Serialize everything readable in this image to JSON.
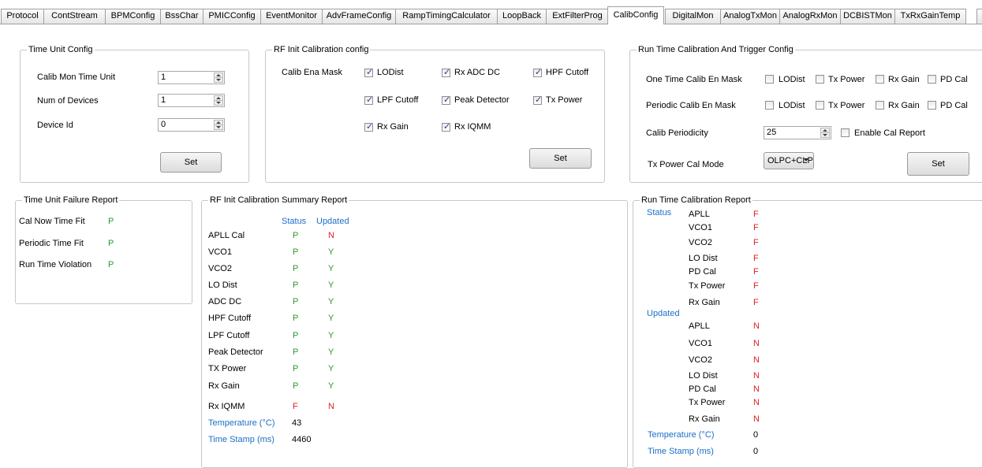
{
  "tabs": [
    "Protocol",
    "ContStream",
    "BPMConfig",
    "BssChar",
    "PMICConfig",
    "EventMonitor",
    "AdvFrameConfig",
    "RampTimingCalculator",
    "LoopBack",
    "ExtFilterProg",
    "CalibConfig",
    "DigitalMon",
    "AnalogTxMon",
    "AnalogRxMon",
    "DCBISTMon",
    "TxRxGainTemp"
  ],
  "active_tab": "CalibConfig",
  "time_unit_config": {
    "title": "Time Unit Config",
    "calib_mon_label": "Calib Mon Time Unit",
    "calib_mon_value": "1",
    "num_devices_label": "Num of  Devices",
    "num_devices_value": "1",
    "device_id_label": "Device Id",
    "device_id_value": "0",
    "set_label": "Set"
  },
  "rf_init_config": {
    "title": "RF Init Calibration config",
    "mask_label": "Calib Ena Mask",
    "checks": [
      {
        "label": "LODist",
        "checked": true
      },
      {
        "label": "Rx ADC DC",
        "checked": true
      },
      {
        "label": "HPF Cutoff",
        "checked": true
      },
      {
        "label": "LPF Cutoff",
        "checked": true
      },
      {
        "label": "Peak Detector",
        "checked": true
      },
      {
        "label": "Tx Power",
        "checked": true
      },
      {
        "label": "Rx Gain",
        "checked": true
      },
      {
        "label": "Rx IQMM",
        "checked": true
      }
    ],
    "set_label": "Set"
  },
  "run_time_config": {
    "title": "Run Time Calibration And Trigger Config",
    "one_time_label": "One Time Calib En Mask",
    "periodic_label": "Periodic Calib En Mask",
    "mask_options": [
      "LODist",
      "Tx Power",
      "Rx Gain",
      "PD Cal"
    ],
    "periodicity_label": "Calib Periodicity",
    "periodicity_value": "25",
    "enable_report_label": "Enable Cal Report",
    "tx_mode_label": "Tx Power Cal Mode",
    "tx_mode_value": "OLPC+CLP",
    "set_label": "Set"
  },
  "failure_report": {
    "title": "Time Unit Failure Report",
    "rows": [
      {
        "label": "Cal Now Time Fit",
        "value": "P"
      },
      {
        "label": "Periodic Time Fit",
        "value": "P"
      },
      {
        "label": "Run Time Violation",
        "value": "P"
      }
    ]
  },
  "summary_report": {
    "title": "RF Init Calibration Summary Report",
    "status_header": "Status",
    "updated_header": "Updated",
    "rows": [
      {
        "label": "APLL Cal",
        "status": "P",
        "updated": "N"
      },
      {
        "label": "VCO1",
        "status": "P",
        "updated": "Y"
      },
      {
        "label": "VCO2",
        "status": "P",
        "updated": "Y"
      },
      {
        "label": "LO Dist",
        "status": "P",
        "updated": "Y"
      },
      {
        "label": "ADC DC",
        "status": "P",
        "updated": "Y"
      },
      {
        "label": "HPF Cutoff",
        "status": "P",
        "updated": "Y"
      },
      {
        "label": "LPF Cutoff",
        "status": "P",
        "updated": "Y"
      },
      {
        "label": "Peak Detector",
        "status": "P",
        "updated": "Y"
      },
      {
        "label": "TX Power",
        "status": "P",
        "updated": "Y"
      },
      {
        "label": "Rx Gain",
        "status": "P",
        "updated": "Y"
      },
      {
        "label": "Rx IQMM",
        "status": "F",
        "updated": "N"
      }
    ],
    "temperature_label": "Temperature (°C)",
    "temperature_value": "43",
    "timestamp_label": "Time Stamp (ms)",
    "timestamp_value": "4460"
  },
  "run_time_report": {
    "title": "Run Time Calibration Report",
    "status_label": "Status",
    "updated_label": "Updated",
    "status_rows": [
      {
        "label": "APLL",
        "value": "F"
      },
      {
        "label": "VCO1",
        "value": "F"
      },
      {
        "label": "VCO2",
        "value": "F"
      },
      {
        "label": "LO Dist",
        "value": "F"
      },
      {
        "label": "PD Cal",
        "value": "F"
      },
      {
        "label": "Tx Power",
        "value": "F"
      },
      {
        "label": "Rx Gain",
        "value": "F"
      }
    ],
    "updated_rows": [
      {
        "label": "APLL",
        "value": "N"
      },
      {
        "label": "VCO1",
        "value": "N"
      },
      {
        "label": "VCO2",
        "value": "N"
      },
      {
        "label": "LO Dist",
        "value": "N"
      },
      {
        "label": "PD Cal",
        "value": "N"
      },
      {
        "label": "Tx Power",
        "value": "N"
      },
      {
        "label": "Rx Gain",
        "value": "N"
      }
    ],
    "temperature_label": "Temperature (°C)",
    "temperature_value": "0",
    "timestamp_label": "Time Stamp (ms)",
    "timestamp_value": "0"
  },
  "colors": {
    "pass": "#2c9a2c",
    "fail": "#e02020",
    "header_blue": "#1c6fc8"
  }
}
